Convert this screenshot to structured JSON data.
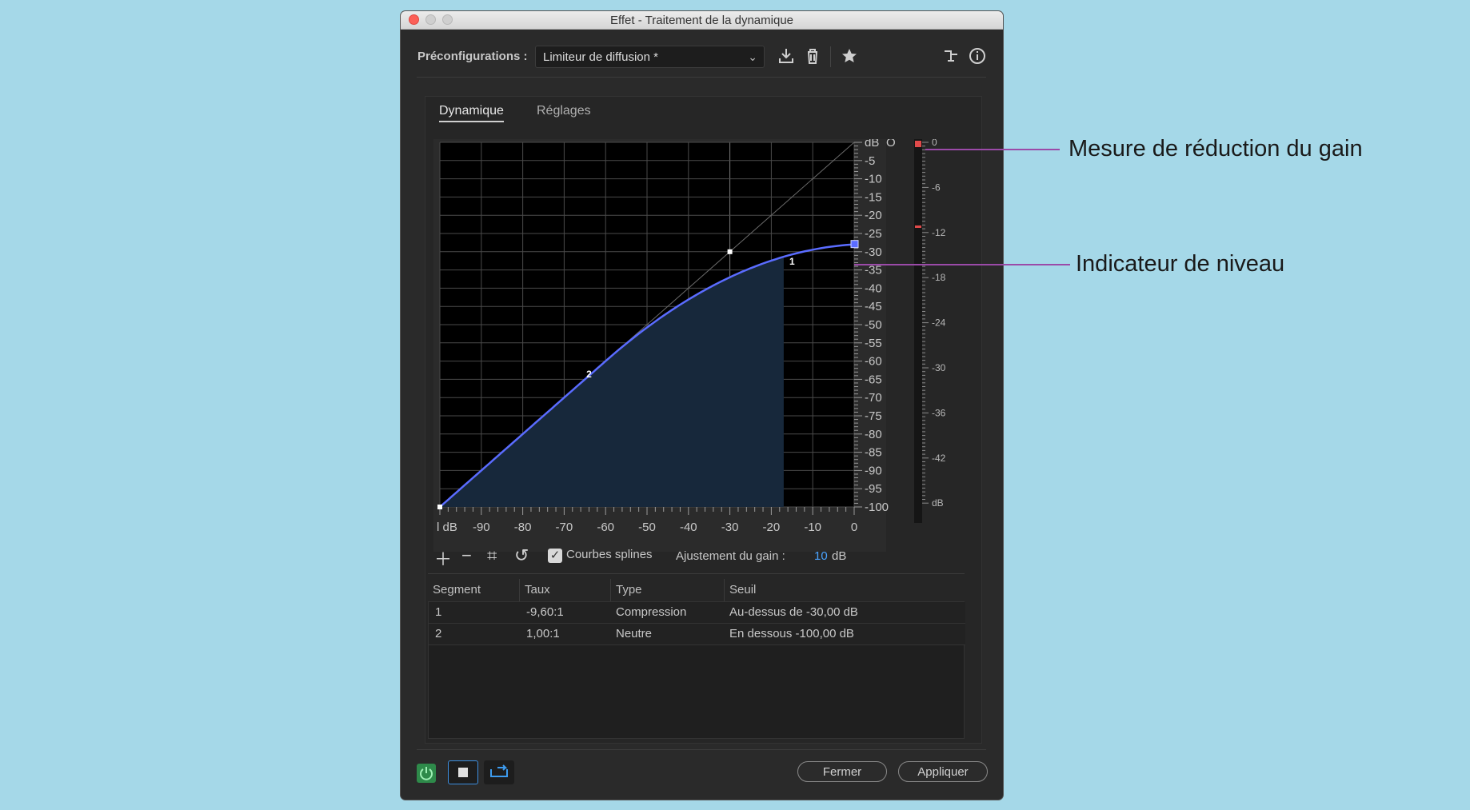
{
  "window": {
    "title": "Effet - Traitement de la dynamique"
  },
  "header": {
    "presets_label": "Préconfigurations :",
    "preset_value": "Limiteur de diffusion *"
  },
  "tabs": [
    {
      "label": "Dynamique",
      "active": true
    },
    {
      "label": "Réglages",
      "active": false
    }
  ],
  "graph": {
    "x_ticks": [
      "dB",
      "-90",
      "-80",
      "-70",
      "-60",
      "-50",
      "-40",
      "-30",
      "-20",
      "-10",
      "0"
    ],
    "y_ticks": [
      "dB",
      "-5",
      "-10",
      "-15",
      "-20",
      "-25",
      "-30",
      "-35",
      "-40",
      "-45",
      "-50",
      "-55",
      "-60",
      "-65",
      "-70",
      "-75",
      "-80",
      "-85",
      "-90",
      "-95",
      "-100"
    ],
    "y_top_zero": "O",
    "points": [
      {
        "label": "1",
        "x": -30,
        "y": -30
      },
      {
        "label": "2",
        "x": -64,
        "y": -64
      }
    ],
    "curve_color": "#5a6cff"
  },
  "meter": {
    "labels": [
      "0",
      "-6",
      "-12",
      "-18",
      "-24",
      "-30",
      "-36",
      "-42",
      "dB"
    ]
  },
  "controls": {
    "splines_label": "Courbes splines",
    "splines_checked": true,
    "gain_label": "Ajustement du gain :",
    "gain_value": "10",
    "gain_unit": "dB"
  },
  "table": {
    "headers": [
      "Segment",
      "Taux",
      "Type",
      "Seuil"
    ],
    "rows": [
      [
        "1",
        "-9,60:1",
        "Compression",
        "Au-dessus de -30,00 dB"
      ],
      [
        "2",
        "1,00:1",
        "Neutre",
        "En dessous -100,00 dB"
      ]
    ]
  },
  "footer": {
    "close_label": "Fermer",
    "apply_label": "Appliquer"
  },
  "annotations": {
    "gain_reduction": "Mesure de réduction du gain",
    "level_indicator": "Indicateur de niveau"
  }
}
